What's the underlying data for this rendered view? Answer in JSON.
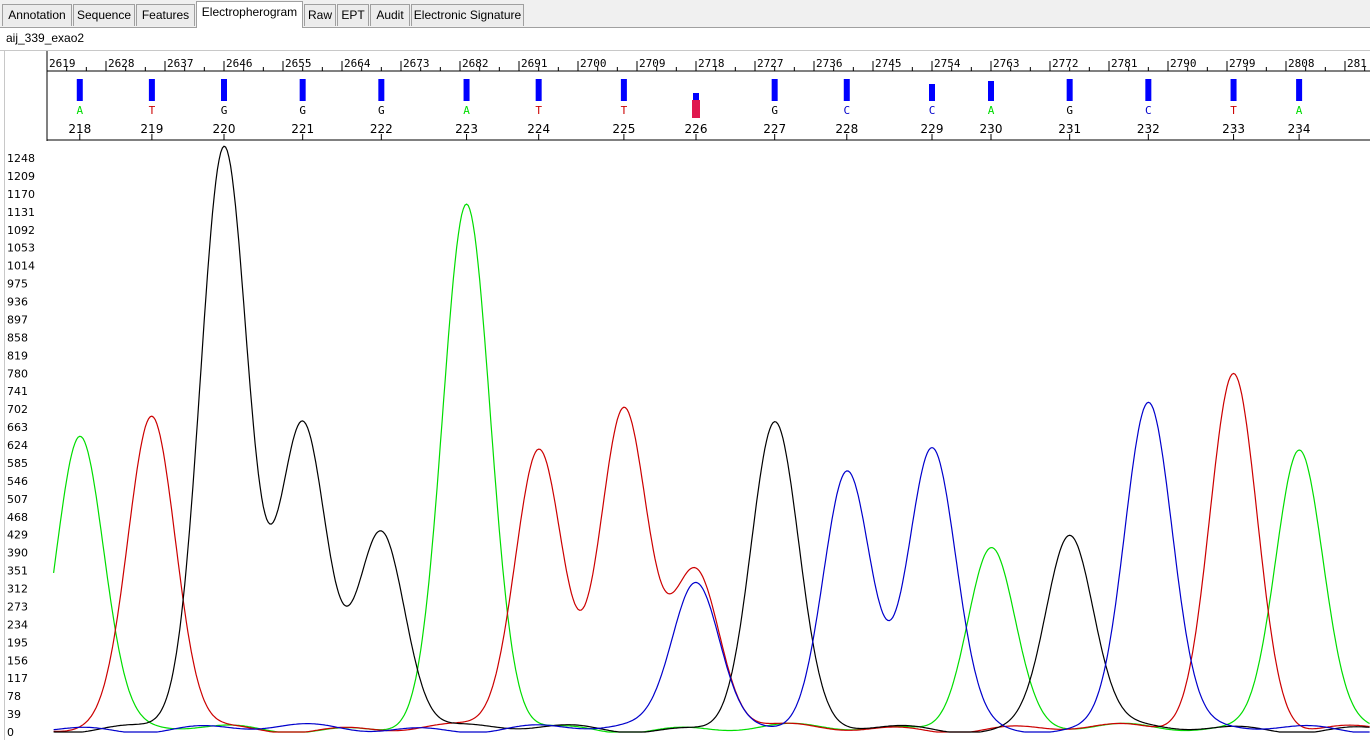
{
  "tabs": [
    {
      "label": "Annotation",
      "active": false
    },
    {
      "label": "Sequence",
      "active": false
    },
    {
      "label": "Features",
      "active": false
    },
    {
      "label": "Electropherogram",
      "active": true
    },
    {
      "label": "Raw",
      "active": false
    },
    {
      "label": "EPT",
      "active": false
    },
    {
      "label": "Audit",
      "active": false
    },
    {
      "label": "Electronic Signature",
      "active": false
    }
  ],
  "file_name": "aij_339_exao2",
  "colors": {
    "A": "#00dd00",
    "T": "#cc0000",
    "G": "#000000",
    "C": "#0000cc",
    "quality_bar": "#0000ff",
    "low_quality": "#e0194f"
  },
  "chart_data": {
    "type": "line",
    "scan_ticks": [
      "2619",
      "2628",
      "2637",
      "2646",
      "2655",
      "2664",
      "2673",
      "2682",
      "2691",
      "2700",
      "2709",
      "2718",
      "2727",
      "2736",
      "2745",
      "2754",
      "2763",
      "2772",
      "2781",
      "2790",
      "2799",
      "2808",
      "281"
    ],
    "y_ticks": [
      "0",
      "39",
      "78",
      "117",
      "156",
      "195",
      "234",
      "273",
      "312",
      "351",
      "390",
      "429",
      "468",
      "507",
      "546",
      "585",
      "624",
      "663",
      "702",
      "741",
      "780",
      "819",
      "858",
      "897",
      "936",
      "975",
      "1014",
      "1053",
      "1092",
      "1131",
      "1170",
      "1209",
      "1248"
    ],
    "ylim": [
      0,
      1248
    ],
    "grid": false,
    "bases": [
      {
        "pos": 218,
        "base": "A",
        "scan": 2624,
        "quality": 0.85,
        "peak": 640
      },
      {
        "pos": 219,
        "base": "T",
        "scan": 2635,
        "quality": 0.85,
        "peak": 675
      },
      {
        "pos": 220,
        "base": "G",
        "scan": 2646,
        "quality": 0.85,
        "peak": 1255
      },
      {
        "pos": 221,
        "base": "G",
        "scan": 2658,
        "quality": 0.85,
        "peak": 670
      },
      {
        "pos": 222,
        "base": "G",
        "scan": 2670,
        "quality": 0.85,
        "peak": 432
      },
      {
        "pos": 223,
        "base": "A",
        "scan": 2683,
        "quality": 0.85,
        "peak": 1130
      },
      {
        "pos": 224,
        "base": "T",
        "scan": 2694,
        "quality": 0.85,
        "peak": 605
      },
      {
        "pos": 225,
        "base": "T",
        "scan": 2707,
        "quality": 0.85,
        "peak": 705
      },
      {
        "pos": 226,
        "base": "T",
        "scan": 2718,
        "quality": 0.3,
        "peak": 340
      },
      {
        "pos": 227,
        "base": "G",
        "scan": 2730,
        "quality": 0.85,
        "peak": 662
      },
      {
        "pos": 228,
        "base": "C",
        "scan": 2741,
        "quality": 0.85,
        "peak": 555
      },
      {
        "pos": 229,
        "base": "C",
        "scan": 2754,
        "quality": 0.65,
        "peak": 610
      },
      {
        "pos": 230,
        "base": "A",
        "scan": 2763,
        "quality": 0.75,
        "peak": 395
      },
      {
        "pos": 231,
        "base": "G",
        "scan": 2775,
        "quality": 0.85,
        "peak": 425
      },
      {
        "pos": 232,
        "base": "C",
        "scan": 2787,
        "quality": 0.85,
        "peak": 715
      },
      {
        "pos": 233,
        "base": "T",
        "scan": 2800,
        "quality": 0.85,
        "peak": 770
      },
      {
        "pos": 234,
        "base": "A",
        "scan": 2810,
        "quality": 0.85,
        "peak": 615
      }
    ],
    "secondary_peaks": [
      {
        "base": "C",
        "scan": 2718,
        "peak": 325
      }
    ]
  }
}
